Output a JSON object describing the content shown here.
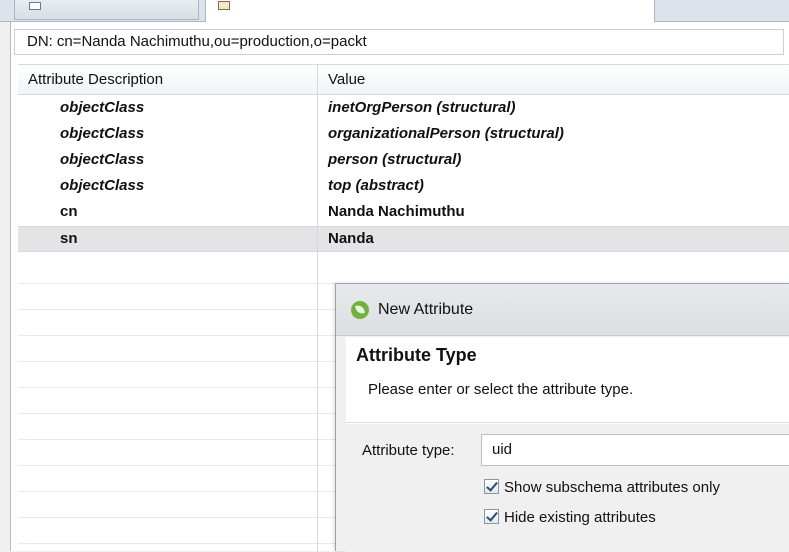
{
  "dn": {
    "prefix": "DN:",
    "value": "cn=Nanda Nachimuthu,ou=production,o=packt"
  },
  "table": {
    "headers": [
      "Attribute Description",
      "Value"
    ],
    "rows": [
      {
        "attribute": "objectClass",
        "value": "inetOrgPerson (structural)",
        "italic": true
      },
      {
        "attribute": "objectClass",
        "value": "organizationalPerson (structural)",
        "italic": true
      },
      {
        "attribute": "objectClass",
        "value": "person (structural)",
        "italic": true
      },
      {
        "attribute": "objectClass",
        "value": "top (abstract)",
        "italic": true
      },
      {
        "attribute": "cn",
        "value": "Nanda Nachimuthu",
        "italic": false
      },
      {
        "attribute": "sn",
        "value": "Nanda",
        "italic": false,
        "selected": true
      }
    ]
  },
  "dialog": {
    "title": "New Attribute",
    "section_title": "Attribute Type",
    "description": "Please enter or select the attribute type.",
    "attribute_type_label": "Attribute type:",
    "attribute_type_value": "uid",
    "show_subschema_label": "Show subschema attributes only",
    "show_subschema_checked": true,
    "hide_existing_label": "Hide existing attributes",
    "hide_existing_checked": true
  },
  "icons": {
    "dialog_icon": "spring-leaf-icon",
    "tab_icon": "entry-editor-icon"
  }
}
